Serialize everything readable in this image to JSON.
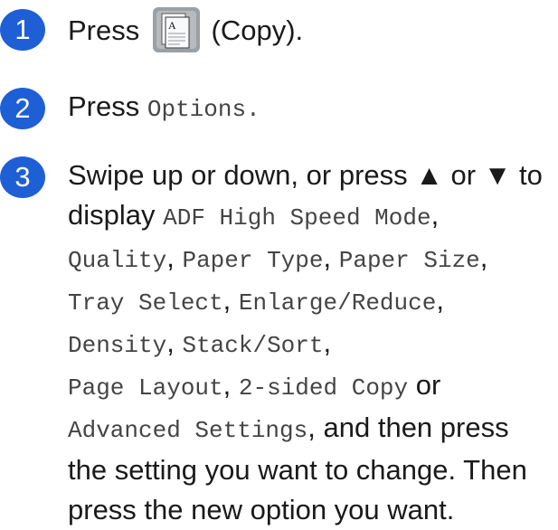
{
  "steps": [
    {
      "number": "1",
      "text_before": "Press",
      "icon": "copy-icon",
      "icon_letter": "A",
      "text_after": "(Copy)."
    },
    {
      "number": "2",
      "text_before": "Press",
      "button_label": "Options",
      "text_after": "."
    },
    {
      "number": "3",
      "intro": "Swipe up or down, or press ▲ or ▼ to display",
      "options": [
        "ADF High Speed Mode",
        "Quality",
        "Paper Type",
        "Paper Size",
        "Tray Select",
        "Enlarge/Reduce",
        "Density",
        "Stack/Sort",
        "Page Layout",
        "2-sided Copy",
        "Advanced Settings"
      ],
      "or_word": "or",
      "outro": "and then press the setting you want to change. Then press the new option you want."
    }
  ],
  "colors": {
    "step_badge": "#1f5fd6",
    "icon_tile": "#9aa0a6"
  }
}
